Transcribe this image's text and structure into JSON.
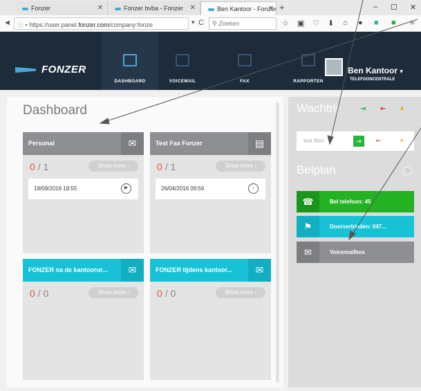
{
  "browser": {
    "tabs": [
      {
        "label": "Fonzer"
      },
      {
        "label": "Fonzer bvba - Fonzer"
      },
      {
        "label": "Ben Kantoor - Fonzer bvb..."
      }
    ],
    "url_prefix": "https://user.panel.",
    "url_domain": "fonzer.com",
    "url_suffix": "/company:fonze",
    "search_placeholder": "Zoeken"
  },
  "app": {
    "logo": "FONZER",
    "nav": [
      {
        "label": "DASHBOARD",
        "active": true
      },
      {
        "label": "VOICEMAIL"
      },
      {
        "label": "FAX"
      },
      {
        "label": "RAPPORTEN"
      }
    ],
    "user_name": "Ben Kantoor",
    "user_role": "TELEFOONCENTRALE"
  },
  "dashboard": {
    "title": "Dashboard",
    "cards": [
      {
        "title": "Personal",
        "count_new": "0",
        "count_total": "/ 1",
        "show_more": "Show more",
        "entry_date": "19/09/2016 18:55",
        "style": "gray",
        "icon": "mail-icon"
      },
      {
        "title": "Test Fax Fonzer",
        "count_new": "0",
        "count_total": "/ 1",
        "show_more": "Show more",
        "entry_date": "26/04/2016 09:56",
        "style": "gray",
        "icon": "fax-icon"
      },
      {
        "title": "FONZER na de kantoorur...",
        "count_new": "0",
        "count_total": "/ 0",
        "show_more": "Show more",
        "style": "teal",
        "icon": "mail-icon"
      },
      {
        "title": "FONZER tijdens kantoor...",
        "count_new": "0",
        "count_total": "/ 0",
        "show_more": "Show more",
        "style": "teal",
        "icon": "mail-icon"
      }
    ]
  },
  "wachtrij": {
    "title": "Wachtrij",
    "queue_item": "test Ben"
  },
  "belplan": {
    "title": "Belplan",
    "rows": [
      {
        "label": "Bel telefoon: 45",
        "color": "#22b222",
        "icon_color": "#1a961a"
      },
      {
        "label": "Doorverbinden: 047...",
        "color": "#18c2d6",
        "icon_color": "#12aec1"
      },
      {
        "label": "Voicemailbox",
        "color": "#8d8f93",
        "icon_color": "#7c7e82"
      }
    ]
  },
  "colors": {
    "nav_bg": "#1d2b3b",
    "accent": "#4aa8d8",
    "count_new": "#e8562f"
  }
}
